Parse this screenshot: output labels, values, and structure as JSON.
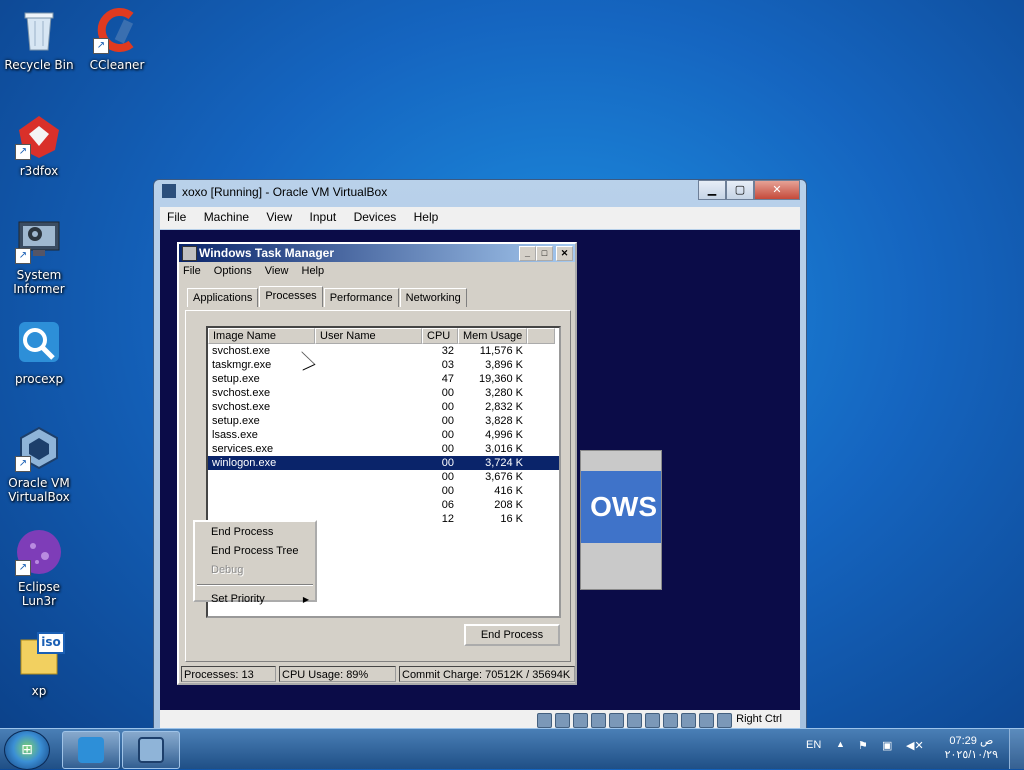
{
  "desktop": {
    "icons": [
      {
        "label": "Recycle Bin",
        "icon": "recycle-bin-icon"
      },
      {
        "label": "CCleaner",
        "icon": "ccleaner-icon"
      },
      {
        "label": "r3dfox",
        "icon": "r3dfox-icon"
      },
      {
        "label": "System\nInformer",
        "icon": "system-informer-icon"
      },
      {
        "label": "procexp",
        "icon": "procexp-icon"
      },
      {
        "label": "Oracle VM\nVirtualBox",
        "icon": "virtualbox-icon"
      },
      {
        "label": "Eclipse Lun3r",
        "icon": "eclipse-icon"
      },
      {
        "label": "xp",
        "icon": "iso-file-icon",
        "badge": "iso"
      }
    ]
  },
  "vbox": {
    "title": "xoxo [Running] - Oracle VM VirtualBox",
    "menu": [
      "File",
      "Machine",
      "View",
      "Input",
      "Devices",
      "Help"
    ],
    "status_right": "Right Ctrl"
  },
  "xp_splash": {
    "logo_text": "OWS"
  },
  "taskmgr": {
    "title": "Windows Task Manager",
    "menu": [
      "File",
      "Options",
      "View",
      "Help"
    ],
    "tabs": [
      "Applications",
      "Processes",
      "Performance",
      "Networking"
    ],
    "active_tab": "Processes",
    "columns": [
      "Image Name",
      "User Name",
      "CPU",
      "Mem Usage"
    ],
    "rows": [
      {
        "name": "svchost.exe",
        "user": "",
        "cpu": "32",
        "mem": "11,576 K"
      },
      {
        "name": "taskmgr.exe",
        "user": "",
        "cpu": "03",
        "mem": "3,896 K"
      },
      {
        "name": "setup.exe",
        "user": "",
        "cpu": "47",
        "mem": "19,360 K"
      },
      {
        "name": "svchost.exe",
        "user": "",
        "cpu": "00",
        "mem": "3,280 K"
      },
      {
        "name": "svchost.exe",
        "user": "",
        "cpu": "00",
        "mem": "2,832 K"
      },
      {
        "name": "setup.exe",
        "user": "",
        "cpu": "00",
        "mem": "3,828 K"
      },
      {
        "name": "lsass.exe",
        "user": "",
        "cpu": "00",
        "mem": "4,996 K"
      },
      {
        "name": "services.exe",
        "user": "",
        "cpu": "00",
        "mem": "3,016 K"
      },
      {
        "name": "winlogon.exe",
        "user": "",
        "cpu": "00",
        "mem": "3,724 K"
      },
      {
        "name": "",
        "user": "",
        "cpu": "00",
        "mem": "3,676 K"
      },
      {
        "name": "",
        "user": "",
        "cpu": "00",
        "mem": "416 K"
      },
      {
        "name": "",
        "user": "",
        "cpu": "06",
        "mem": "208 K"
      },
      {
        "name": "",
        "user": "",
        "cpu": "12",
        "mem": "16 K"
      }
    ],
    "selected_row": "winlogon.exe",
    "end_process_button": "End Process",
    "status": {
      "processes": "Processes: 13",
      "cpu": "CPU Usage: 89%",
      "commit": "Commit Charge: 70512K / 35694K"
    },
    "context_menu": {
      "items": [
        "End Process",
        "End Process Tree",
        "Debug"
      ],
      "disabled": [
        "Debug"
      ],
      "priority": "Set Priority"
    }
  },
  "taskbar": {
    "lang": "EN",
    "time": "07:29 ص",
    "date": "٢٠٢٥/١٠/٢٩"
  }
}
